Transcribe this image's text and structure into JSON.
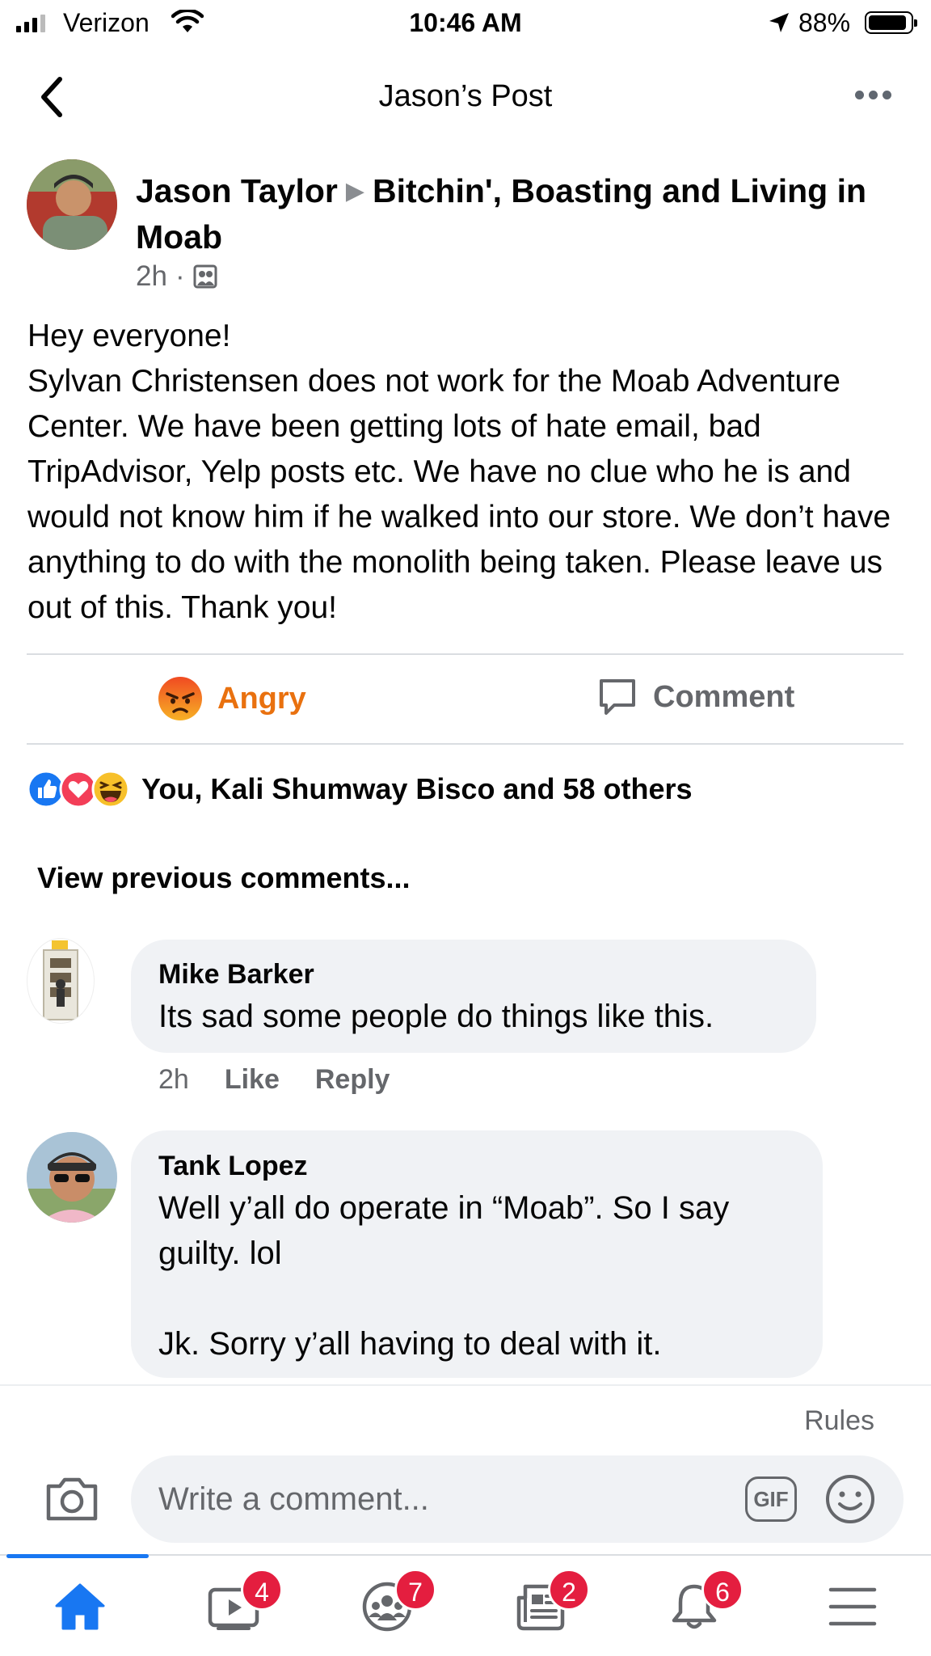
{
  "status_bar": {
    "carrier": "Verizon",
    "time": "10:46 AM",
    "battery": "88%",
    "battery_level": 0.88
  },
  "header": {
    "title": "Jason’s Post"
  },
  "post": {
    "author": "Jason Taylor",
    "group": "Bitchin', Boasting and Living in Moab",
    "time": "2h",
    "separator": "·",
    "body": [
      "Hey everyone!",
      "Sylvan Christensen does not work for the Moab Adventure Center. We have been getting lots of hate email, bad TripAdvisor, Yelp posts etc. We have no clue who he is and would not know him if he walked into our store. We don’t have anything to do with the monolith being taken. Please leave us out of this. Thank you!"
    ]
  },
  "actions": {
    "angry_label": "Angry",
    "comment_label": "Comment",
    "angry_color": "#e9710f"
  },
  "reactions": {
    "icons": [
      "like-icon",
      "love-icon",
      "haha-icon"
    ],
    "summary": "You, Kali Shumway Bisco and 58 others"
  },
  "comments": {
    "view_previous": "View previous comments...",
    "items": [
      {
        "name": "Mike Barker",
        "text": "Its sad some people do things like this.",
        "time": "2h",
        "like": "Like",
        "reply": "Reply"
      },
      {
        "name": "Tank Lopez",
        "text_line1": "Well y’all do operate in “Moab”. So I say guilty. lol",
        "text_line2": "Jk. Sorry y’all having to deal with it."
      }
    ]
  },
  "composer": {
    "rules": "Rules",
    "placeholder": "Write a comment...",
    "gif": "GIF"
  },
  "bottom_nav": {
    "accent": "#1877f2",
    "badge_color": "#e41e3f",
    "items": [
      {
        "icon": "home-icon",
        "badge": ""
      },
      {
        "icon": "watch-icon",
        "badge": "4"
      },
      {
        "icon": "groups-icon",
        "badge": "7"
      },
      {
        "icon": "news-icon",
        "badge": "2"
      },
      {
        "icon": "bell-icon",
        "badge": "6"
      },
      {
        "icon": "menu-icon",
        "badge": ""
      }
    ]
  }
}
